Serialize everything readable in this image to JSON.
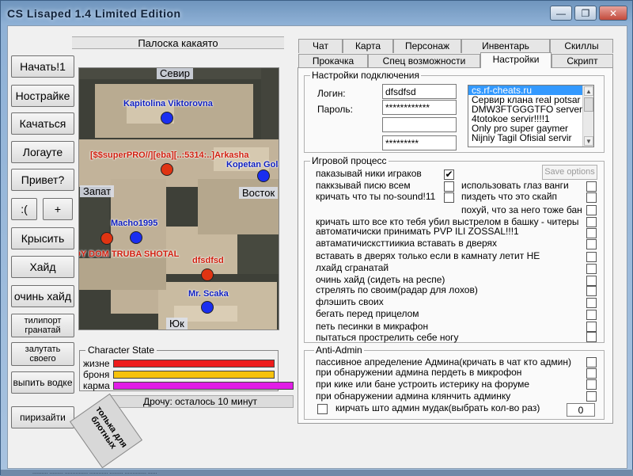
{
  "window": {
    "title": "CS Lisaped 1.4 Limited Edition",
    "min_glyph": "—",
    "max_glyph": "❐",
    "close_glyph": "✕"
  },
  "left_buttons": [
    {
      "id": "start",
      "label": "Начать!1"
    },
    {
      "id": "settings",
      "label": "Нострайке"
    },
    {
      "id": "pump",
      "label": "Качаться"
    },
    {
      "id": "logout",
      "label": "Логауте"
    },
    {
      "id": "hello",
      "label": "Привет?"
    },
    {
      "id": "sad",
      "label": ":("
    },
    {
      "id": "plus",
      "label": "+"
    },
    {
      "id": "krysit",
      "label": "Крысить"
    },
    {
      "id": "hide",
      "label": "Хайд"
    },
    {
      "id": "very-hide",
      "label": "очинь хайд"
    },
    {
      "id": "teleport",
      "label": "тилипорт гранатай"
    },
    {
      "id": "zalutat",
      "label": "залутать своего"
    },
    {
      "id": "vodka",
      "label": "выпить водке"
    },
    {
      "id": "pirizaiti",
      "label": "пиризайти"
    }
  ],
  "map": {
    "header": "Палоска какаято",
    "directions": {
      "north": "Севир",
      "west": "Запат",
      "east": "Восток",
      "south": "Юк"
    },
    "players": [
      {
        "name": "Kapitolina Viktorovna",
        "team": "blue"
      },
      {
        "name": "[$$superPRO//][eba][..:5314:..]Arkasha",
        "team": "red"
      },
      {
        "name": "Kopetan Golak",
        "team": "blue"
      },
      {
        "name": "Macho1995",
        "team": "blue"
      },
      {
        "name": "DY DOM TRUBA SHOTAL",
        "team": "red"
      },
      {
        "name": "dfsdfsd",
        "team": "red"
      },
      {
        "name": "Mr. Scaka",
        "team": "blue"
      }
    ]
  },
  "character_state": {
    "title": "Character State",
    "rows": [
      {
        "label": "жизне",
        "color": "#ee1c1c",
        "value": 1.0
      },
      {
        "label": "броня",
        "color": "#f6c20c",
        "value": 1.0
      },
      {
        "label": "карма",
        "color": "#e11de6",
        "value": 1.0
      }
    ]
  },
  "status_text": "Дрочу: осталось 10 минут",
  "rotated_note": "толька для блотных",
  "tabs_row1": [
    "Чат",
    "Карта",
    "Персонаж",
    "Инвентарь",
    "Скиллы"
  ],
  "tabs_row2": [
    "Прокачка",
    "Спец возможности",
    "Настройки",
    "Скрипт"
  ],
  "connection": {
    "legend": "Настройки подключения",
    "login_label": "Логин:",
    "login_value": "dfsdfsd",
    "password_label": "Пароль:",
    "password_value": "************",
    "extra1_value": "",
    "extra2_value": "*********",
    "servers": [
      "cs.rf-cheats.ru",
      "Сервир клана real potsar",
      "DMW3FTGGGTFO server",
      "4totokoe servir!!!!1",
      "Only pro super gaymer",
      "Nijniy Tagil Ofisial servir"
    ],
    "selected_server": 0
  },
  "game": {
    "legend": "Игровой процесс",
    "save_label": "Save options",
    "options_left": [
      {
        "label": "паказывай ники играков",
        "checked": true
      },
      {
        "label": "паккзывай писю всем",
        "checked": false
      },
      {
        "label": "кричать что ты no-sound!11",
        "checked": false
      }
    ],
    "options_right": [
      {
        "label": "использовать глаз ванги",
        "checked": false
      },
      {
        "label": "пиздеть что это скайп",
        "checked": false
      },
      {
        "label": "похуй, что за него тоже бан",
        "checked": false
      }
    ],
    "options_full": [
      {
        "label": "кричать што все кто тебя убил выстрелом в башку - читеры",
        "checked": false
      },
      {
        "label": "автоматичиски принимать PVP ILI ZOSSAL!!!1",
        "checked": false
      },
      {
        "label": "автаматичисксттиикиа вставать в дверях",
        "checked": false
      },
      {
        "label": "вставать в дверях только если в камнату летит НЕ",
        "checked": false
      },
      {
        "label": "лхайд сгранатай",
        "checked": false
      },
      {
        "label": "очинь хайд (сидеть на респе)",
        "checked": false
      },
      {
        "label": "стрелять по своим(радар для лохов)",
        "checked": false
      },
      {
        "label": "флэшить своих",
        "checked": false
      },
      {
        "label": "бегать перед прицелом",
        "checked": false
      },
      {
        "label": "петь песинки в микрафон",
        "checked": false
      },
      {
        "label": "пытаться прострелить себе ногу",
        "checked": false
      }
    ]
  },
  "anti_admin": {
    "legend": "Anti-Admin",
    "options": [
      {
        "label": "пассивное апределение Админа(кричать в чат кто админ)",
        "checked": false
      },
      {
        "label": "при обнаружении админа пердеть в микрофон",
        "checked": false
      },
      {
        "label": "при кике или бане устроить истерику на форуме",
        "checked": false
      },
      {
        "label": "при обнаружении админа клянчить админку",
        "checked": false
      }
    ],
    "last_option": {
      "label": "кирчать што админ мудак(выбрать кол-во раз)",
      "checked": false
    },
    "count_value": "0"
  },
  "bottom_text": "..........  .........  ...............  ............  .........  ..............  ......"
}
